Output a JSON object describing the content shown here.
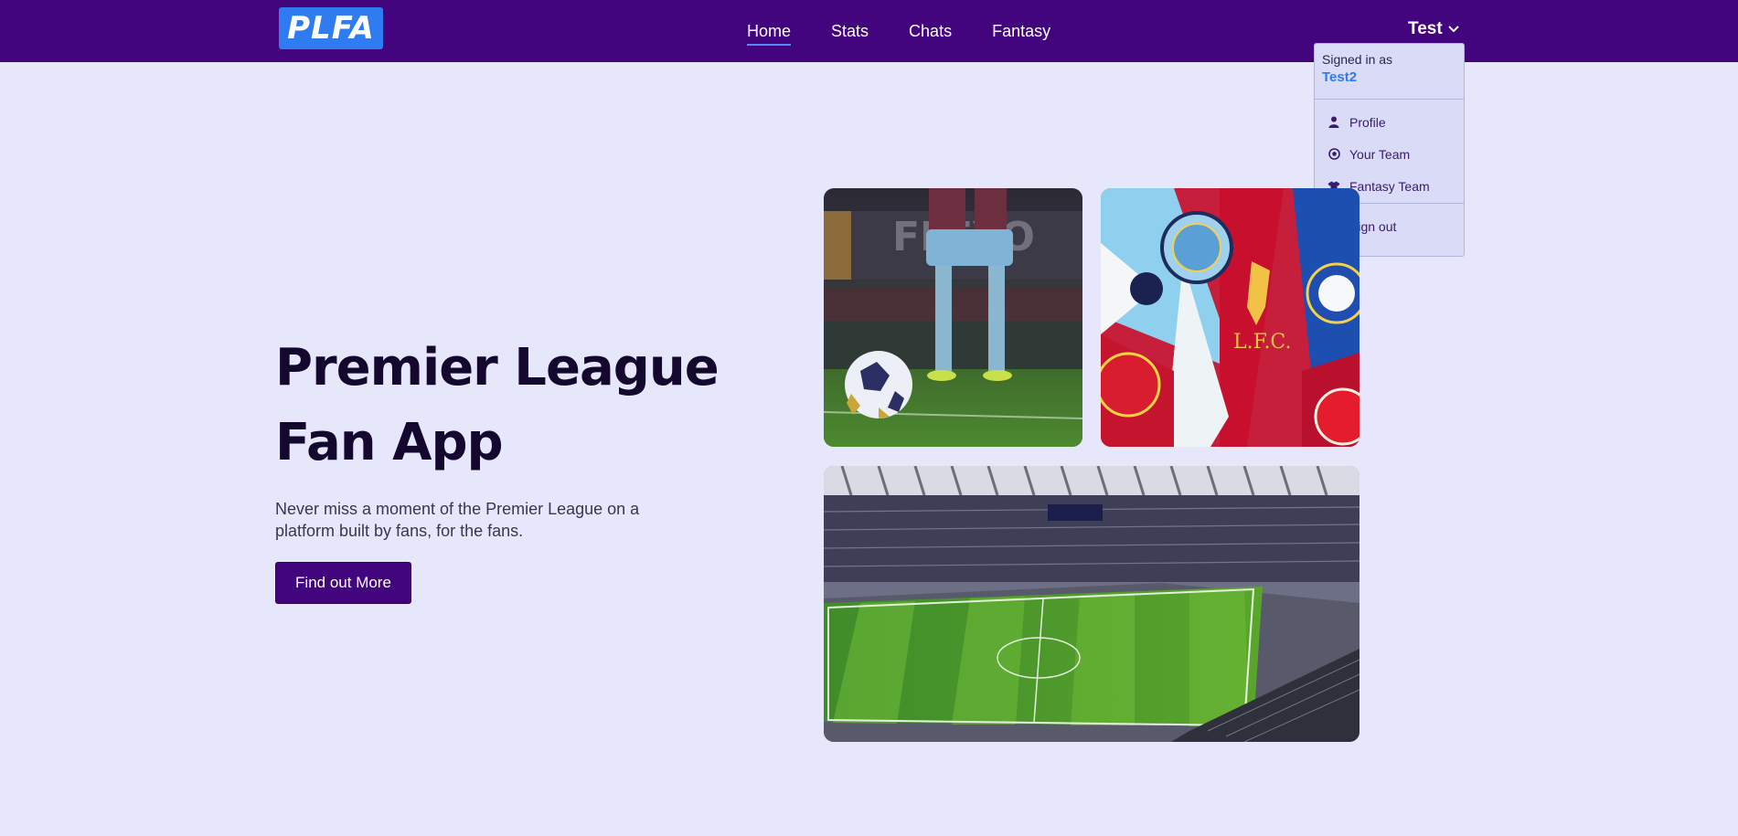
{
  "brand": {
    "logo_text": "PLFA",
    "logo_color": "#2f7bf0",
    "nav_color": "#43057e"
  },
  "nav": {
    "links": [
      {
        "label": "Home",
        "active": true
      },
      {
        "label": "Stats",
        "active": false
      },
      {
        "label": "Chats",
        "active": false
      },
      {
        "label": "Fantasy",
        "active": false
      }
    ]
  },
  "user_menu": {
    "username": "Test",
    "signed_in_label": "Signed in as",
    "signed_in_user": "Test2",
    "items": [
      {
        "label": "Profile",
        "icon": "person-icon"
      },
      {
        "label": "Your Team",
        "icon": "football-icon"
      },
      {
        "label": "Fantasy Team",
        "icon": "shirt-icon"
      }
    ],
    "sign_out": {
      "label": "Sign out",
      "icon": "sign-out-icon"
    }
  },
  "hero": {
    "title_line1": "Premier League",
    "title_line2": "Fan App",
    "description": "Never miss a moment of the Premier League on a platform built by fans, for the fans.",
    "cta_label": "Find out More"
  },
  "images": [
    {
      "name": "football-on-pitch-image"
    },
    {
      "name": "club-crests-flags-image"
    },
    {
      "name": "stadium-image"
    }
  ]
}
